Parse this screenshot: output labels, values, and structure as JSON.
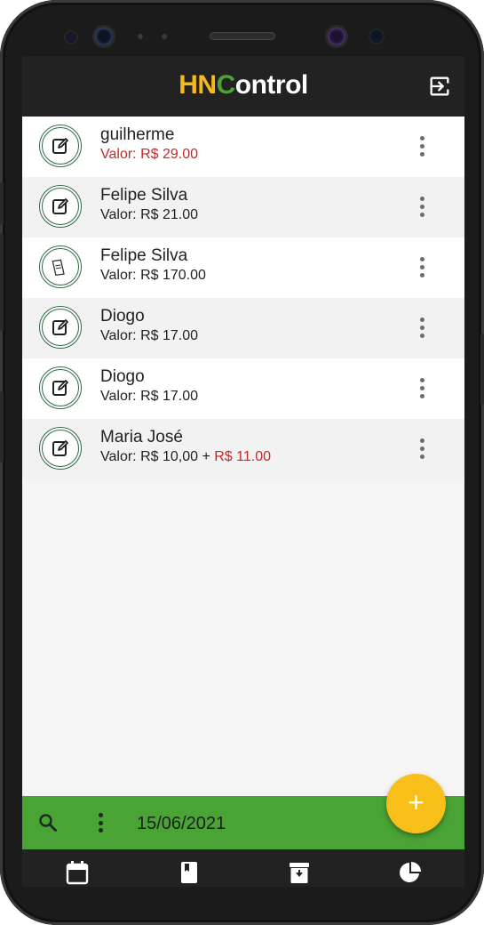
{
  "app_bar": {
    "title_hn": "HN",
    "title_c": "C",
    "title_rest": "ontrol",
    "logout_icon": "logout-icon"
  },
  "items": [
    {
      "name": "guilherme",
      "value_label": "Valor: ",
      "value": "R$ 29.00",
      "value_extra": "",
      "icon": "edit-note-icon",
      "highlight": true
    },
    {
      "name": "Felipe Silva",
      "value_label": "Valor: ",
      "value": "R$ 21.00",
      "value_extra": "",
      "icon": "edit-note-icon",
      "highlight": false
    },
    {
      "name": "Felipe Silva",
      "value_label": "Valor: ",
      "value": "R$ 170.00",
      "value_extra": "",
      "icon": "ticket-icon",
      "highlight": false
    },
    {
      "name": "Diogo",
      "value_label": "Valor: ",
      "value": "R$ 17.00",
      "value_extra": "",
      "icon": "edit-note-icon",
      "highlight": false
    },
    {
      "name": "Diogo",
      "value_label": "Valor: ",
      "value": "R$ 17.00",
      "value_extra": "",
      "icon": "edit-note-icon",
      "highlight": false
    },
    {
      "name": "Maria José",
      "value_label": "Valor: ",
      "value": "R$ 10,00 + ",
      "value_extra": "R$ 11.00",
      "icon": "edit-note-icon",
      "highlight": false
    }
  ],
  "bottom_bar": {
    "date": "15/06/2021",
    "fab_label": "+"
  },
  "bottom_nav": [
    "calendar-icon",
    "book-icon",
    "archive-icon",
    "pie-chart-icon"
  ],
  "colors": {
    "accent_green": "#4aa335",
    "brand_yellow": "#f6b91c",
    "fab_yellow": "#f8bf1a",
    "bar_dark": "#222222",
    "value_red": "#c62828"
  }
}
